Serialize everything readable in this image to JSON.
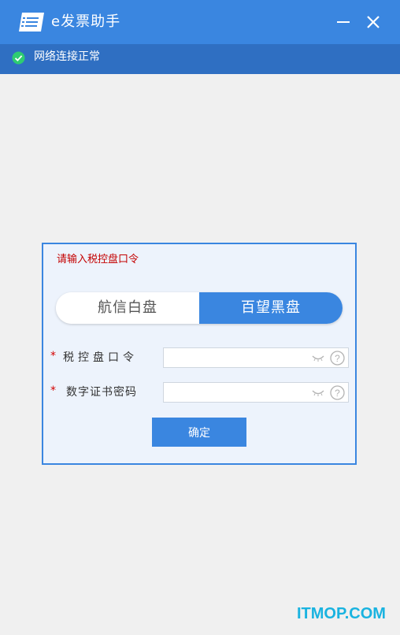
{
  "window": {
    "title": "e发票助手",
    "minimize_icon": "minimize-icon",
    "close_icon": "close-icon",
    "accent_color": "#3a86e0",
    "status_bar_color": "#2f6fc2"
  },
  "status": {
    "icon": "check-circle-icon",
    "text": "网络连接正常",
    "color": "#2ecc71"
  },
  "dialog": {
    "heading": "请输入税控盘口令",
    "disk_type": {
      "options": [
        "航信白盘",
        "百望黑盘"
      ],
      "selected": "百望黑盘"
    },
    "fields": [
      {
        "label": "税控盘口令",
        "value": "",
        "required_mark": "*"
      },
      {
        "label": "数字证书密码",
        "value": "",
        "required_mark": "*"
      }
    ],
    "confirm_label": "确定"
  },
  "watermark": "ITMOP.COM"
}
